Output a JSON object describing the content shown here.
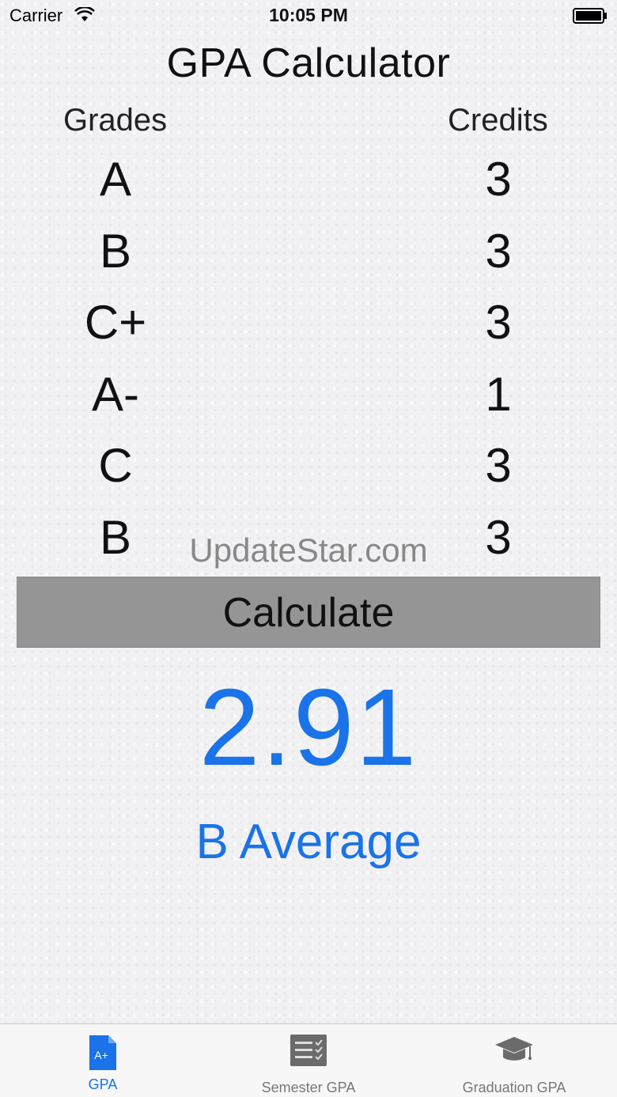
{
  "status_bar": {
    "carrier": "Carrier",
    "time": "10:05 PM"
  },
  "title": "GPA Calculator",
  "headers": {
    "grades": "Grades",
    "credits": "Credits"
  },
  "rows": [
    {
      "grade": "A",
      "credits": "3"
    },
    {
      "grade": "B",
      "credits": "3"
    },
    {
      "grade": "C+",
      "credits": "3"
    },
    {
      "grade": "A-",
      "credits": "1"
    },
    {
      "grade": "C",
      "credits": "3"
    },
    {
      "grade": "B",
      "credits": "3"
    }
  ],
  "watermark": "UpdateStar.com",
  "calculate_label": "Calculate",
  "result": {
    "gpa": "2.91",
    "average": "B Average"
  },
  "tabs": [
    {
      "label": "GPA",
      "icon": "gpa-document-icon",
      "selected": true
    },
    {
      "label": "Semester GPA",
      "icon": "checklist-icon",
      "selected": false
    },
    {
      "label": "Graduation GPA",
      "icon": "graduation-cap-icon",
      "selected": false
    }
  ],
  "colors": {
    "accent": "#1a73e8",
    "button_bg": "#959595"
  }
}
